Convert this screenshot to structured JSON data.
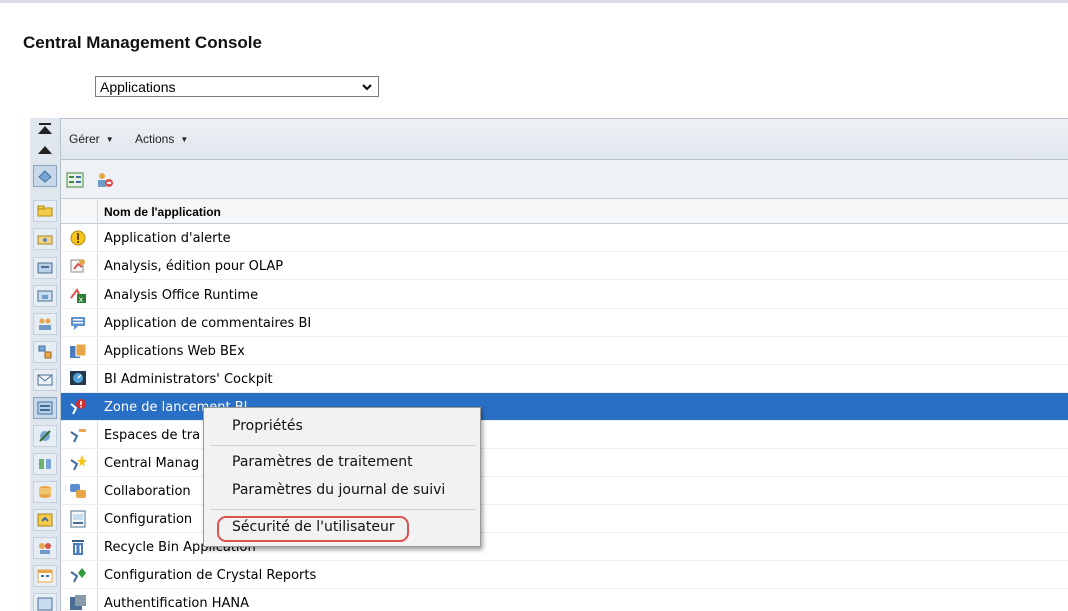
{
  "page": {
    "title": "Central Management Console"
  },
  "selector": {
    "value": "Applications"
  },
  "toolbar": {
    "manage_label": "Gérer",
    "actions_label": "Actions"
  },
  "table": {
    "header": "Nom de l'application",
    "rows": [
      {
        "label": "Application d'alerte",
        "icon": "alert-icon"
      },
      {
        "label": "Analysis, édition pour OLAP",
        "icon": "analysis-olap-icon"
      },
      {
        "label": "Analysis Office Runtime",
        "icon": "analysis-office-icon"
      },
      {
        "label": "Application de commentaires BI",
        "icon": "comment-icon"
      },
      {
        "label": "Applications Web BEx",
        "icon": "bex-web-icon"
      },
      {
        "label": "BI Administrators' Cockpit",
        "icon": "cockpit-icon"
      },
      {
        "label": "Zone de lancement BI",
        "icon": "launchpad-icon"
      },
      {
        "label": "Espaces de tra",
        "icon": "workspace-icon"
      },
      {
        "label": "Central Manag",
        "icon": "cmc-icon"
      },
      {
        "label": "Collaboration",
        "icon": "collaboration-icon"
      },
      {
        "label": "Configuration",
        "icon": "configuration-icon"
      },
      {
        "label": "Recycle Bin Application",
        "icon": "recycle-bin-icon"
      },
      {
        "label": "Configuration de Crystal Reports",
        "icon": "crystal-reports-icon"
      },
      {
        "label": "Authentification HANA",
        "icon": "hana-auth-icon"
      }
    ],
    "selected_index": 6
  },
  "context_menu": {
    "items": [
      {
        "label": "Propriétés"
      },
      {
        "label": "Paramètres de traitement"
      },
      {
        "label": "Paramètres du journal de suivi"
      },
      {
        "label": "Sécurité de l'utilisateur"
      }
    ],
    "highlighted_index": 3
  },
  "colors": {
    "selection": "#2a6fc6",
    "highlight_ring": "#d9534f"
  }
}
